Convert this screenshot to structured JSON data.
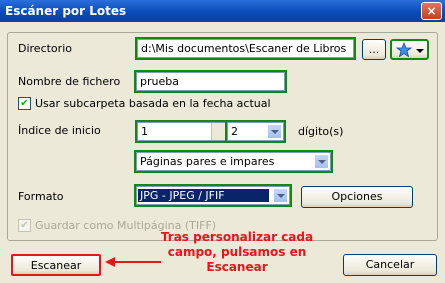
{
  "window": {
    "title": "Escáner por Lotes",
    "close_glyph": "×"
  },
  "form": {
    "directorio_label": "Directorio",
    "directorio_value": "d:\\Mis documentos\\Escaner de Libros",
    "browse_label": "...",
    "favorite_icon": "star-icon",
    "nombre_label": "Nombre de fichero",
    "nombre_value": "prueba",
    "subcarpeta_label": "Usar subcarpeta basada en la fecha actual",
    "subcarpeta_checked": true,
    "indice_label": "Índice de inicio",
    "indice_value": "1",
    "digitos_value": "2",
    "digitos_label": "dígito(s)",
    "paginas_value": "Páginas pares e impares",
    "formato_label": "Formato",
    "formato_value": "JPG - JPEG / JFIF",
    "opciones_label": "Opciones",
    "multipagina_label": "Guardar como Multipágina (TIFF)",
    "multipagina_checked": true
  },
  "footer": {
    "escanear_label": "Escanear",
    "cancelar_label": "Cancelar"
  },
  "annotation": {
    "text": "Tras personalizar cada campo, pulsamos en Escanear",
    "color": "#e8151b"
  },
  "colors": {
    "highlight_green": "#118811",
    "highlight_red": "#e8151b",
    "selection_blue": "#0a246a"
  }
}
